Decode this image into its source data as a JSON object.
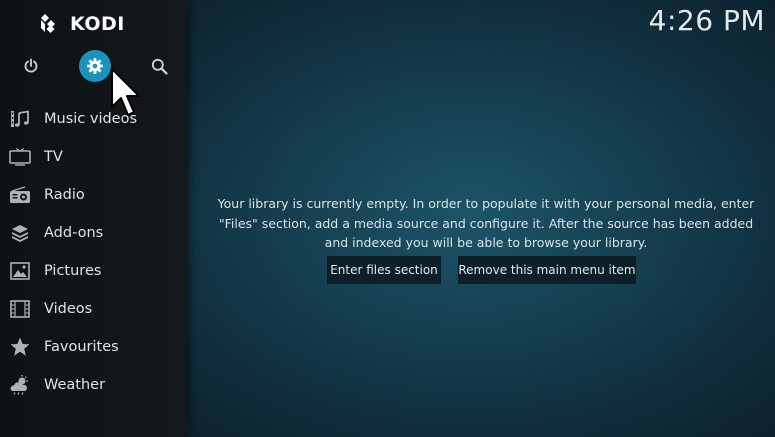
{
  "app": {
    "name": "KODI"
  },
  "clock": "4:26 PM",
  "top_buttons": [
    {
      "icon": "power-icon"
    },
    {
      "icon": "gear-icon",
      "active": true
    },
    {
      "icon": "search-icon"
    }
  ],
  "menu": [
    {
      "label": "Music videos",
      "icon": "music-video-icon"
    },
    {
      "label": "TV",
      "icon": "tv-icon"
    },
    {
      "label": "Radio",
      "icon": "radio-icon"
    },
    {
      "label": "Add-ons",
      "icon": "addons-icon"
    },
    {
      "label": "Pictures",
      "icon": "pictures-icon"
    },
    {
      "label": "Videos",
      "icon": "videos-icon"
    },
    {
      "label": "Favourites",
      "icon": "star-icon"
    },
    {
      "label": "Weather",
      "icon": "weather-icon"
    }
  ],
  "main": {
    "message": "Your library is currently empty. In order to populate it with your personal media, enter \"Files\" section, add a media source and configure it. After the source has been added and indexed you will be able to browse your library.",
    "buttons": {
      "enter_files": "Enter files section",
      "remove_item": "Remove this main menu item"
    }
  },
  "colors": {
    "accent": "#1a93b8",
    "sidebar_bg": "#111619",
    "background": "#153f50"
  }
}
